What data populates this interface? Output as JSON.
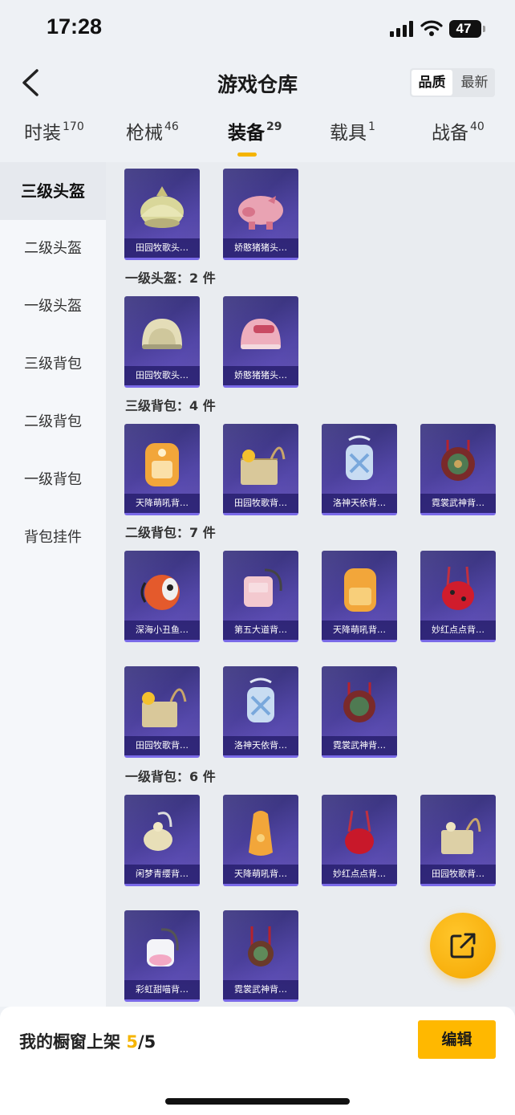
{
  "status_bar": {
    "time": "17:28",
    "battery": "47"
  },
  "header": {
    "title": "游戏仓库",
    "sort_options": [
      {
        "label": "品质",
        "active": true
      },
      {
        "label": "最新",
        "active": false
      }
    ]
  },
  "tabs": [
    {
      "label": "时装",
      "count": "170"
    },
    {
      "label": "枪械",
      "count": "46"
    },
    {
      "label": "装备",
      "count": "29",
      "active": true
    },
    {
      "label": "载具",
      "count": "1"
    },
    {
      "label": "战备",
      "count": "40"
    }
  ],
  "sidebar": [
    {
      "label": "三级头盔",
      "active": true
    },
    {
      "label": "二级头盔"
    },
    {
      "label": "一级头盔"
    },
    {
      "label": "三级背包"
    },
    {
      "label": "二级背包"
    },
    {
      "label": "一级背包"
    },
    {
      "label": "背包挂件"
    }
  ],
  "sections": [
    {
      "title": "",
      "items": [
        "田园牧歌头…",
        "娇憨猪猪头…"
      ]
    },
    {
      "title": "一级头盔：2 件",
      "items": [
        "田园牧歌头…",
        "娇憨猪猪头…"
      ]
    },
    {
      "title": "三级背包：4 件",
      "items": [
        "天降萌吼背…",
        "田园牧歌背…",
        "洛神天依背…",
        "霓裳武神背…"
      ]
    },
    {
      "title": "二级背包：7 件",
      "items": [
        "深海小丑鱼…",
        "第五大道背…",
        "天降萌吼背…",
        "妙红点点背…",
        "田园牧歌背…",
        "洛神天依背…",
        "霓裳武神背…"
      ]
    },
    {
      "title": "一级背包：6 件",
      "items": [
        "闲梦青缨背…",
        "天降萌吼背…",
        "妙红点点背…",
        "田园牧歌背…",
        "彩虹甜喵背…",
        "霓裳武神背…"
      ]
    }
  ],
  "footer": {
    "label": "我的橱窗上架",
    "current": "5",
    "total": "/5",
    "edit_label": "编辑"
  },
  "icons": {
    "back": "chevron-left-icon",
    "fab": "share-out-icon"
  },
  "colors": {
    "accent": "#ffb800",
    "card": "#4a3f9a"
  }
}
